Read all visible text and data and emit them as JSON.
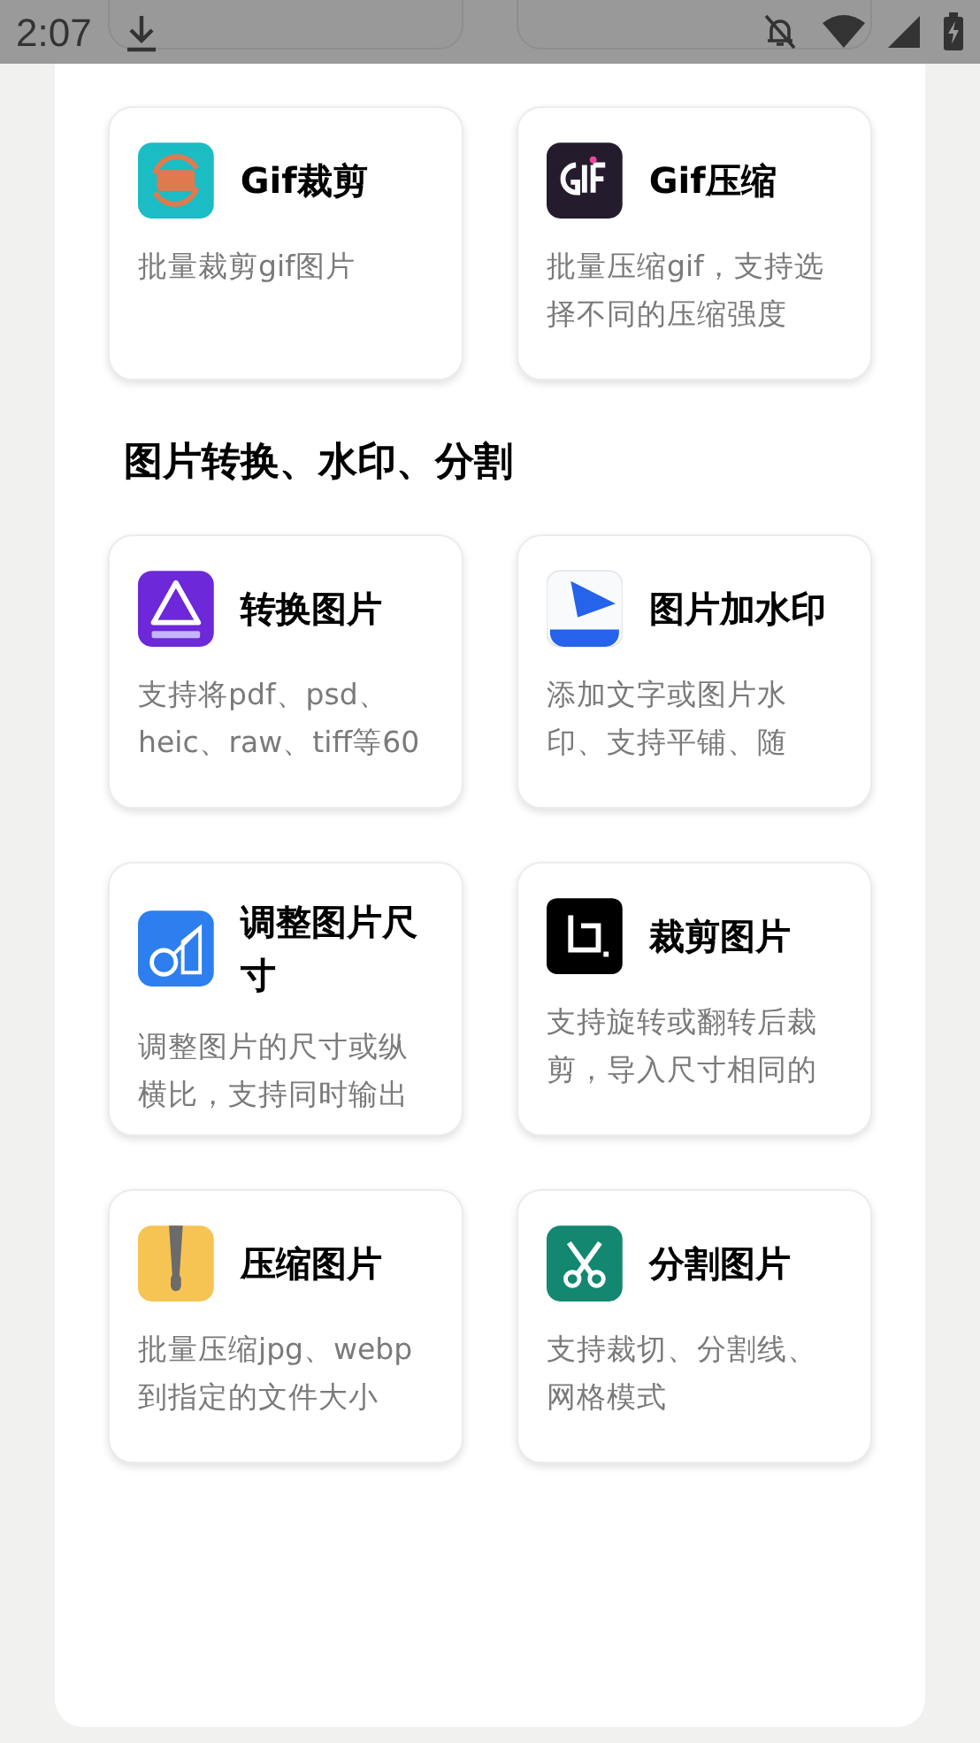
{
  "status_bar": {
    "time": "2:07"
  },
  "groups": [
    {
      "tools": [
        {
          "title": "Gif裁剪",
          "description": "批量裁剪gif图片"
        },
        {
          "title": "Gif压缩",
          "description": "批量压缩gif，支持选择不同的压缩强度"
        }
      ]
    },
    {
      "heading": "图片转换、水印、分割",
      "tools": [
        {
          "title": "转换图片",
          "description": "支持将pdf、psd、heic、raw、tiff等60"
        },
        {
          "title": "图片加水印",
          "description": "添加文字或图片水印、支持平铺、随"
        },
        {
          "title": "调整图片尺寸",
          "description": "调整图片的尺寸或纵横比，支持同时输出"
        },
        {
          "title": "裁剪图片",
          "description": "支持旋转或翻转后裁剪，导入尺寸相同的"
        },
        {
          "title": "压缩图片",
          "description": "批量压缩jpg、webp到指定的文件大小"
        },
        {
          "title": "分割图片",
          "description": "支持裁切、分割线、网格模式"
        }
      ]
    }
  ]
}
